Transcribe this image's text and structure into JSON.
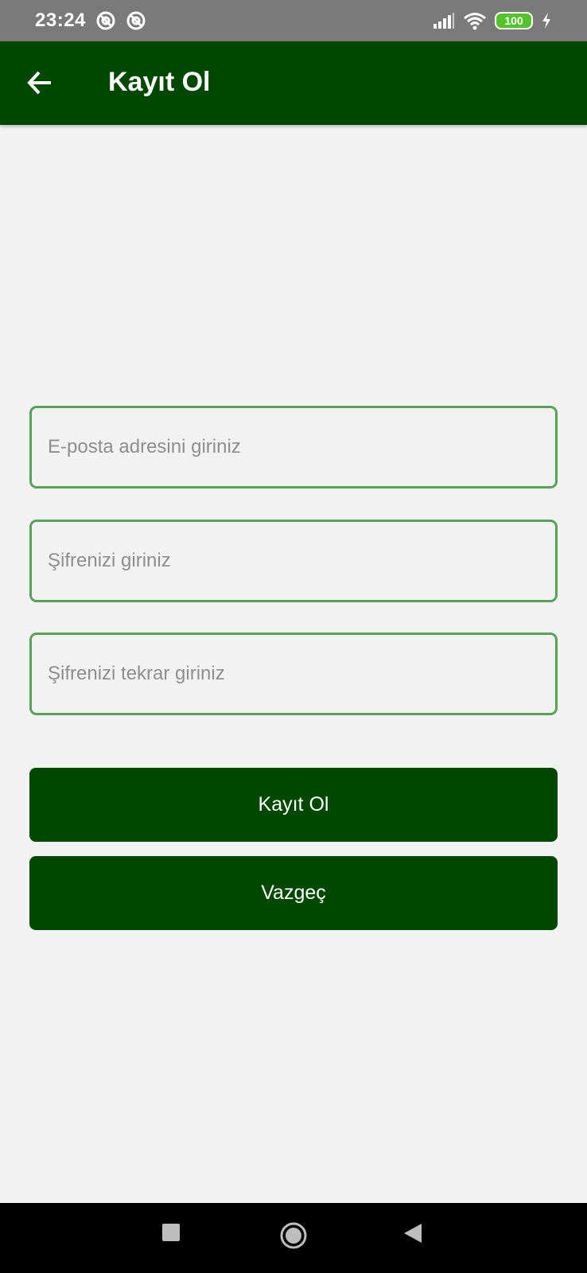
{
  "status_bar": {
    "time": "23:24",
    "battery": "100",
    "notification_icons": [
      "at-sign-icon",
      "at-sign-icon"
    ],
    "system_icons": [
      "signal-icon",
      "wifi-icon",
      "battery-icon",
      "charging-icon"
    ]
  },
  "app_bar": {
    "title": "Kayıt Ol",
    "back_icon": "arrow-left-icon",
    "background_color": "#004800"
  },
  "form": {
    "email_placeholder": "E-posta adresini giriniz",
    "password_placeholder": "Şifrenizi giriniz",
    "password_confirm_placeholder": "Şifrenizi tekrar giriniz",
    "field_border_color": "#5aa05a"
  },
  "buttons": {
    "register_label": "Kayıt Ol",
    "cancel_label": "Vazgeç",
    "color": "#004800"
  },
  "nav_bar": {
    "icons": [
      "recents-square-icon",
      "home-circle-icon",
      "back-triangle-icon"
    ]
  }
}
